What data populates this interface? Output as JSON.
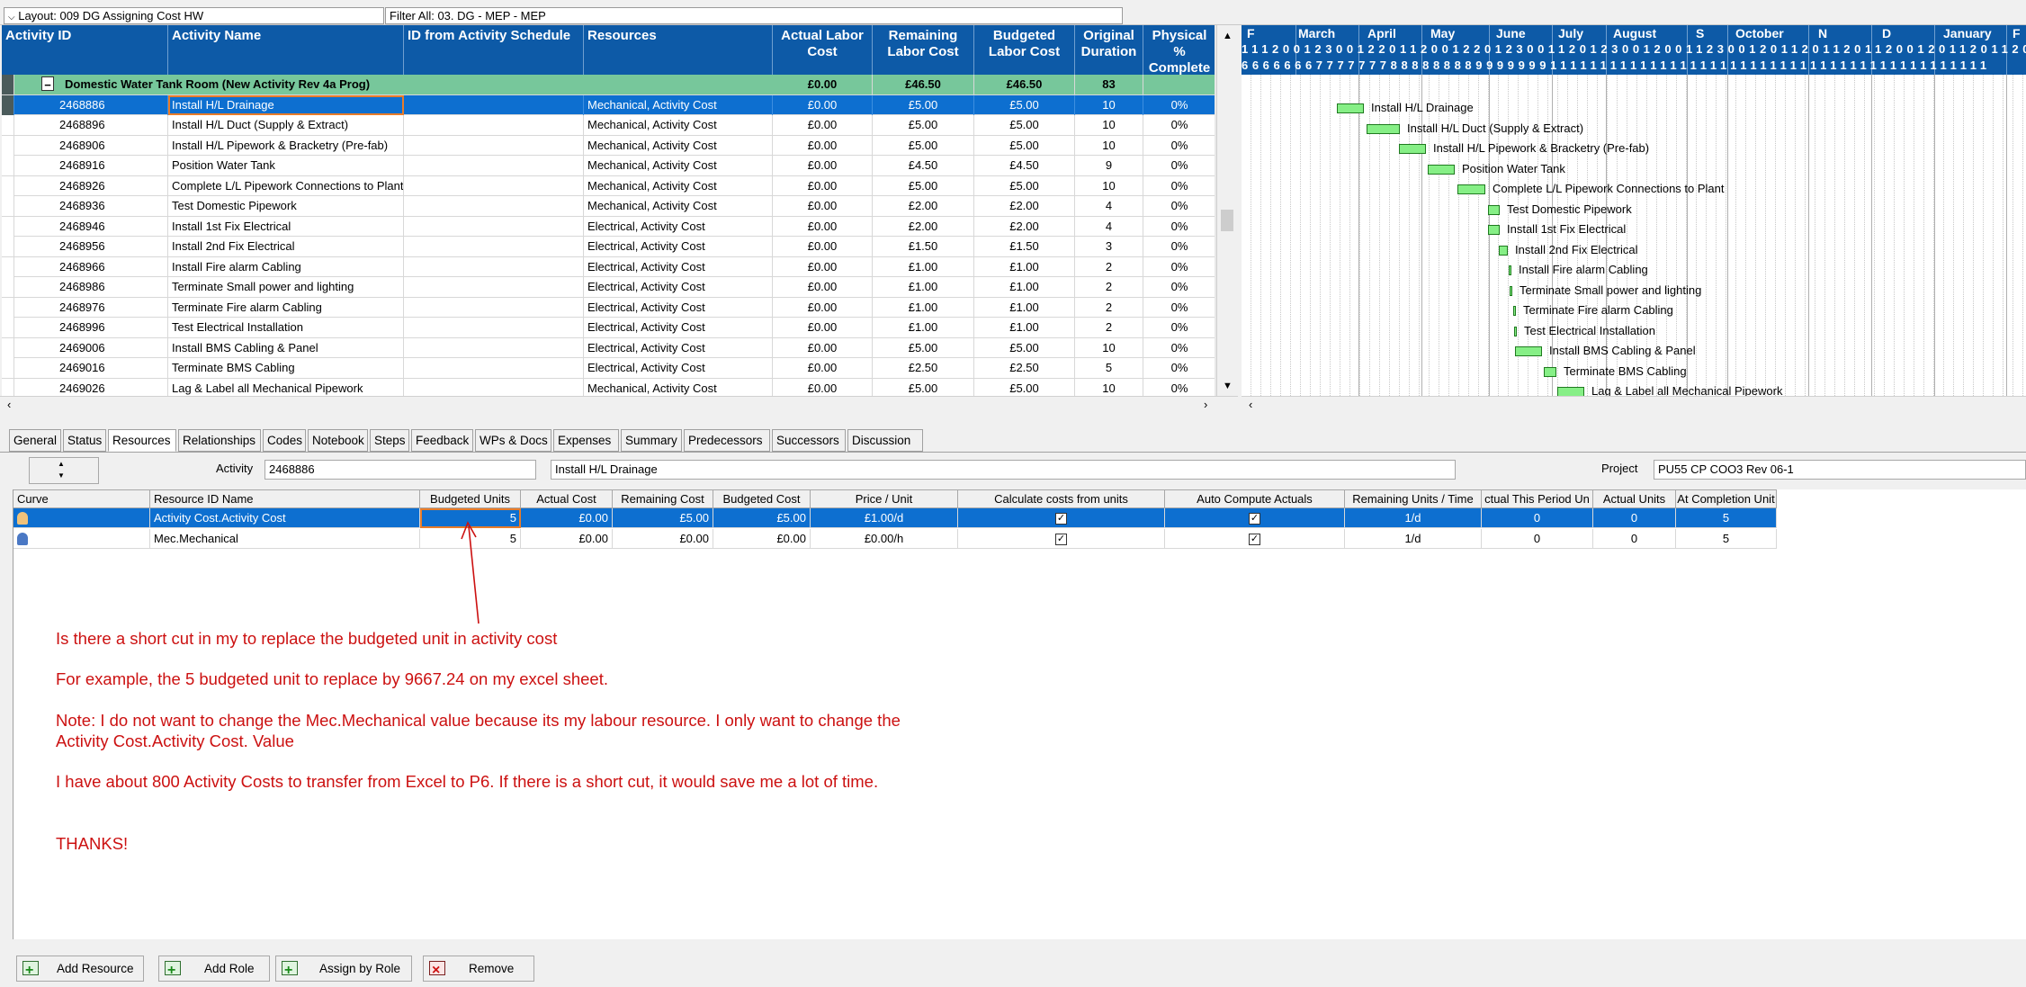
{
  "topbar": {
    "layout": "Layout: 009 DG Assigning Cost HW",
    "filter": "Filter All: 03. DG - MEP - MEP"
  },
  "grid": {
    "columns": [
      "Activity ID",
      "Activity Name",
      "ID from Activity Schedule",
      "Resources",
      "Actual Labor Cost",
      "Remaining Labor Cost",
      "Budgeted Labor Cost",
      "Original Duration",
      "Physical % Complete"
    ],
    "group": {
      "label": "Domestic Water Tank Room (New Activity Rev 4a Prog)",
      "actual": "£0.00",
      "remaining": "£46.50",
      "budgeted": "£46.50",
      "duration": "83"
    },
    "rows": [
      {
        "id": "2468886",
        "name": "Install H/L Drainage",
        "res": "Mechanical, Activity Cost",
        "actual": "£0.00",
        "remaining": "£5.00",
        "budgeted": "£5.00",
        "dur": "10",
        "pct": "0%"
      },
      {
        "id": "2468896",
        "name": "Install H/L Duct (Supply & Extract)",
        "res": "Mechanical, Activity Cost",
        "actual": "£0.00",
        "remaining": "£5.00",
        "budgeted": "£5.00",
        "dur": "10",
        "pct": "0%"
      },
      {
        "id": "2468906",
        "name": "Install H/L Pipework & Bracketry (Pre-fab)",
        "res": "Mechanical, Activity Cost",
        "actual": "£0.00",
        "remaining": "£5.00",
        "budgeted": "£5.00",
        "dur": "10",
        "pct": "0%"
      },
      {
        "id": "2468916",
        "name": "Position Water Tank",
        "res": "Mechanical, Activity Cost",
        "actual": "£0.00",
        "remaining": "£4.50",
        "budgeted": "£4.50",
        "dur": "9",
        "pct": "0%"
      },
      {
        "id": "2468926",
        "name": "Complete L/L Pipework Connections to Plant",
        "res": "Mechanical, Activity Cost",
        "actual": "£0.00",
        "remaining": "£5.00",
        "budgeted": "£5.00",
        "dur": "10",
        "pct": "0%"
      },
      {
        "id": "2468936",
        "name": "Test Domestic Pipework",
        "res": "Mechanical, Activity Cost",
        "actual": "£0.00",
        "remaining": "£2.00",
        "budgeted": "£2.00",
        "dur": "4",
        "pct": "0%"
      },
      {
        "id": "2468946",
        "name": "Install 1st Fix Electrical",
        "res": "Electrical, Activity Cost",
        "actual": "£0.00",
        "remaining": "£2.00",
        "budgeted": "£2.00",
        "dur": "4",
        "pct": "0%"
      },
      {
        "id": "2468956",
        "name": "Install 2nd Fix Electrical",
        "res": "Electrical, Activity Cost",
        "actual": "£0.00",
        "remaining": "£1.50",
        "budgeted": "£1.50",
        "dur": "3",
        "pct": "0%"
      },
      {
        "id": "2468966",
        "name": "Install Fire alarm Cabling",
        "res": "Electrical, Activity Cost",
        "actual": "£0.00",
        "remaining": "£1.00",
        "budgeted": "£1.00",
        "dur": "2",
        "pct": "0%"
      },
      {
        "id": "2468986",
        "name": "Terminate Small power and lighting",
        "res": "Electrical, Activity Cost",
        "actual": "£0.00",
        "remaining": "£1.00",
        "budgeted": "£1.00",
        "dur": "2",
        "pct": "0%"
      },
      {
        "id": "2468976",
        "name": "Terminate Fire alarm Cabling",
        "res": "Electrical, Activity Cost",
        "actual": "£0.00",
        "remaining": "£1.00",
        "budgeted": "£1.00",
        "dur": "2",
        "pct": "0%"
      },
      {
        "id": "2468996",
        "name": "Test Electrical Installation",
        "res": "Electrical, Activity Cost",
        "actual": "£0.00",
        "remaining": "£1.00",
        "budgeted": "£1.00",
        "dur": "2",
        "pct": "0%"
      },
      {
        "id": "2469006",
        "name": "Install BMS Cabling & Panel",
        "res": "Electrical, Activity Cost",
        "actual": "£0.00",
        "remaining": "£5.00",
        "budgeted": "£5.00",
        "dur": "10",
        "pct": "0%"
      },
      {
        "id": "2469016",
        "name": "Terminate BMS Cabling",
        "res": "Electrical, Activity Cost",
        "actual": "£0.00",
        "remaining": "£2.50",
        "budgeted": "£2.50",
        "dur": "5",
        "pct": "0%"
      },
      {
        "id": "2469026",
        "name": "Lag & Label all Mechanical Pipework",
        "res": "Mechanical, Activity Cost",
        "actual": "£0.00",
        "remaining": "£5.00",
        "budgeted": "£5.00",
        "dur": "10",
        "pct": "0%"
      }
    ]
  },
  "gantt": {
    "months": [
      "F",
      "March",
      "April",
      "May",
      "June",
      "July",
      "August",
      "S",
      "October",
      "N",
      "D",
      "January",
      "F"
    ],
    "row1": "1112001230012201120012201230011201230012001123001201120112011200120112011200",
    "row2": "6666666777777788888888999999911111111111111111111111111111111111111111111"
  },
  "tabs": [
    "General",
    "Status",
    "Resources",
    "Relationships",
    "Codes",
    "Notebook",
    "Steps",
    "Feedback",
    "WPs & Docs",
    "Expenses",
    "Summary",
    "Predecessors",
    "Successors",
    "Discussion"
  ],
  "detail": {
    "activity_label": "Activity",
    "activity_id": "2468886",
    "activity_name": "Install H/L Drainage",
    "project_label": "Project",
    "project_value": "PU55 CP COO3 Rev 06-1"
  },
  "resources": {
    "columns": [
      "Curve",
      "Resource ID Name",
      "Budgeted Units",
      "Actual Cost",
      "Remaining Cost",
      "Budgeted Cost",
      "Price / Unit",
      "Calculate costs from units",
      "Auto Compute Actuals",
      "Remaining Units / Time",
      "ctual This Period Un",
      "Actual Units",
      "At Completion Unit"
    ],
    "rows": [
      {
        "name": "Activity Cost.Activity Cost",
        "units": "5",
        "actual": "£0.00",
        "remaining": "£5.00",
        "budgeted": "£5.00",
        "price": "£1.00/d",
        "rut": "1/d",
        "atp": "0",
        "au": "0",
        "acu": "5"
      },
      {
        "name": "Mec.Mechanical",
        "units": "5",
        "actual": "£0.00",
        "remaining": "£0.00",
        "budgeted": "£0.00",
        "price": "£0.00/h",
        "rut": "1/d",
        "atp": "0",
        "au": "0",
        "acu": "5"
      }
    ]
  },
  "notes": [
    "Is there a short cut in my to replace the budgeted unit in activity cost",
    "For example, the 5 budgeted unit to replace by 9667.24 on my excel sheet.",
    "Note: I do not want to change the Mec.Mechanical value because its my labour resource. I only want to change the Activity Cost.Activity Cost. Value",
    "I have about 800 Activity Costs to transfer from Excel to P6. If there is a short cut, it would save me a lot of time.",
    "THANKS!"
  ],
  "buttons": {
    "add_resource": "Add Resource",
    "add_role": "Add Role",
    "assign_by_role": "Assign by Role",
    "remove": "Remove"
  },
  "colors": {
    "header_blue": "#0d5aa7",
    "selection_blue": "#0d6fd0",
    "group_green": "#77c79b",
    "bar_green": "#86ef86",
    "note_red": "#cc1111"
  }
}
